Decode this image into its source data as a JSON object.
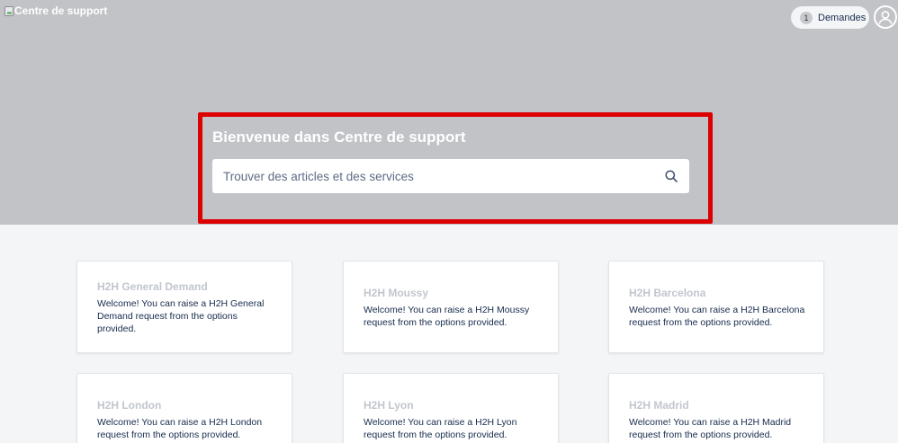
{
  "header": {
    "logo_alt": "Centre de support",
    "requests": {
      "count": "1",
      "label": "Demandes"
    }
  },
  "hero": {
    "title": "Bienvenue dans Centre de support",
    "search_placeholder": "Trouver des articles et des services"
  },
  "projects": [
    {
      "title": "H2H General Demand",
      "description": "Welcome! You can raise a H2H General Demand request from the options provided."
    },
    {
      "title": "H2H Moussy",
      "description": "Welcome! You can raise a H2H Moussy request from the options provided."
    },
    {
      "title": "H2H Barcelona",
      "description": "Welcome! You can raise a H2H Barcelona request from the options provided."
    },
    {
      "title": "H2H London",
      "description": "Welcome! You can raise a H2H London request from the options provided."
    },
    {
      "title": "H2H Lyon",
      "description": "Welcome! You can raise a H2H Lyon request from the options provided."
    },
    {
      "title": "H2H Madrid",
      "description": "Welcome! You can raise a H2H Madrid request from the options provided."
    }
  ],
  "colors": {
    "hero_bg": "#c1c3c6",
    "page_bg": "#f4f5f7",
    "highlight": "#dd0000",
    "text_dark": "#172b4d"
  }
}
